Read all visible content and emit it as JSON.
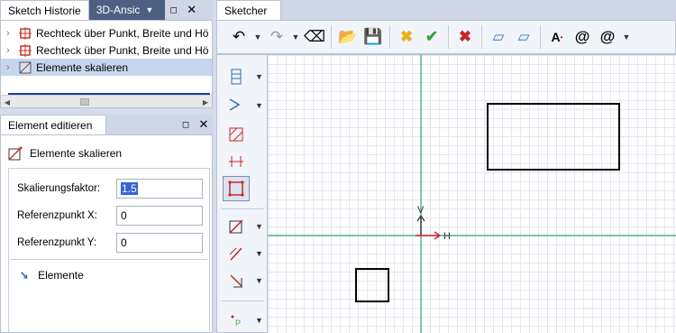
{
  "history": {
    "tabs": [
      "Sketch Historie",
      "3D-Ansic"
    ],
    "items": [
      {
        "label": "Rechteck über Punkt, Breite und Hö"
      },
      {
        "label": "Rechteck über Punkt, Breite und Hö"
      },
      {
        "label": "Elemente skalieren"
      }
    ]
  },
  "edit": {
    "tab": "Element editieren",
    "title": "Elemente skalieren",
    "fields": [
      {
        "label": "Skalierungsfaktor:",
        "value": "1.5"
      },
      {
        "label": "Referenzpunkt X:",
        "value": "0"
      },
      {
        "label": "Referenzpunkt Y:",
        "value": "0"
      }
    ],
    "elements_label": "Elemente"
  },
  "sketcher": {
    "tab": "Sketcher",
    "axis_h": "H",
    "axis_v": "V"
  },
  "icons": {
    "undo": "undo-icon",
    "redo": "redo-icon",
    "clear": "clear-icon",
    "open": "open-folder-icon",
    "save": "save-icon",
    "delete_x": "delete-icon",
    "check": "check-icon",
    "cancel": "cancel-icon",
    "eraser": "eraser-icon",
    "eraser_c": "eraser-c-icon",
    "text": "text-icon",
    "at": "at-icon",
    "at2": "at-settings-icon"
  },
  "colors": {
    "axis": "#2eab6f",
    "accent": "#1a3ab0",
    "tab_inactive": "#4d6082"
  }
}
